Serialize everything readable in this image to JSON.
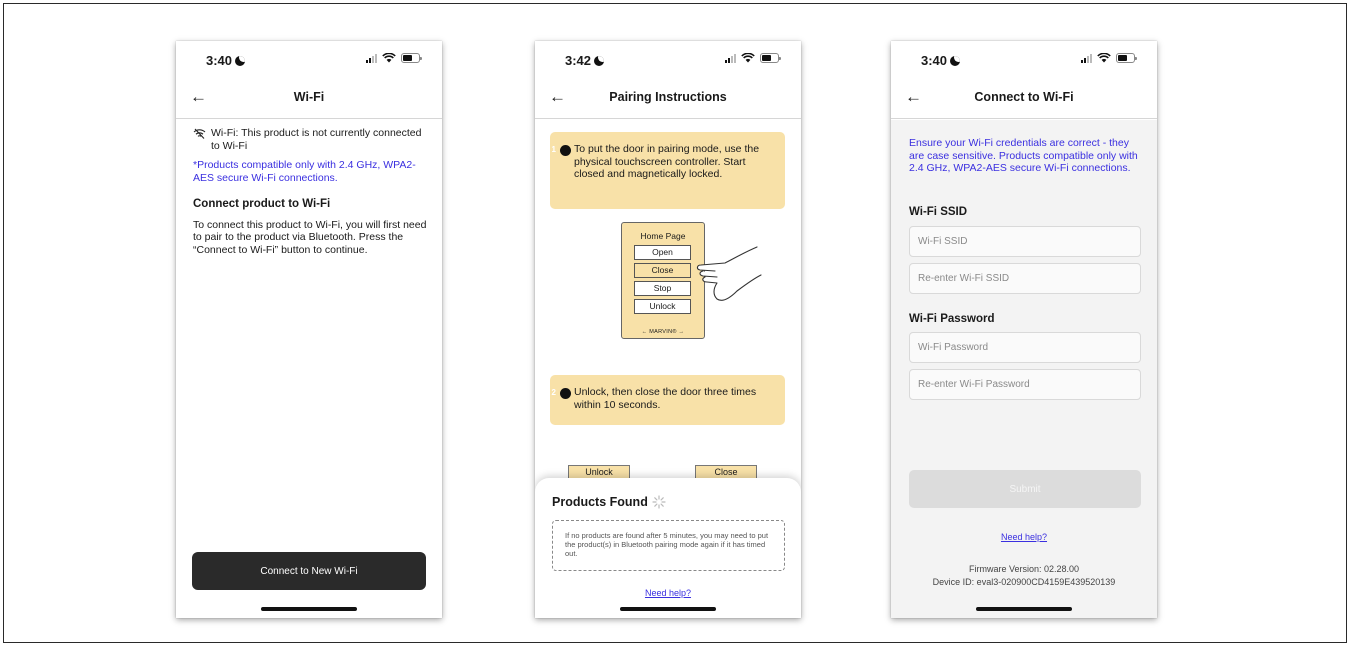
{
  "screens": [
    {
      "status_time": "3:40",
      "title": "Wi-Fi",
      "wifi_status": "Wi-Fi: This product is not currently connected to Wi-Fi",
      "compat_note": "*Products compatible only with 2.4 GHz, WPA2-AES secure Wi-Fi connections.",
      "section_heading": "Connect product to Wi-Fi",
      "section_text": "To connect this product to Wi-Fi, you will first need to pair to the product via Bluetooth. Press the “Connect to Wi-Fi” button to continue.",
      "button_label": "Connect to New Wi-Fi"
    },
    {
      "status_time": "3:42",
      "title": "Pairing Instructions",
      "step1_num": "1",
      "step1_text": "To put the door in pairing mode, use the physical touchscreen controller. Start closed and magnetically locked.",
      "controller": {
        "header": "Home Page",
        "buttons": [
          "Open",
          "Close",
          "Stop",
          "Unlock"
        ],
        "brand": "← MARVIN® →"
      },
      "step2_num": "2",
      "step2_text": "Unlock, then close the door three times within 10 seconds.",
      "mini_buttons": [
        "Unlock",
        "Close"
      ],
      "sheet_title": "Products Found",
      "sheet_note": "If no products are found after 5 minutes, you may need to put the product(s) in Bluetooth pairing mode again if it has timed out.",
      "help_link": "Need help?"
    },
    {
      "status_time": "3:40",
      "title": "Connect to Wi-Fi",
      "intro": "Ensure your Wi-Fi credentials are correct - they are case sensitive. Products compatible only with 2.4 GHz, WPA2-AES secure Wi-Fi connections.",
      "ssid_label": "Wi-Fi SSID",
      "ssid_placeholder": "Wi-Fi SSID",
      "ssid_confirm_placeholder": "Re-enter Wi-Fi SSID",
      "password_label": "Wi-Fi Password",
      "password_placeholder": "Wi-Fi Password",
      "password_confirm_placeholder": "Re-enter Wi-Fi Password",
      "submit_label": "Submit",
      "help_link": "Need help?",
      "firmware": "Firmware Version: 02.28.00",
      "device_id": "Device ID: eval3-020900CD4159E439520139"
    }
  ],
  "colors": {
    "accent_blue": "#3a2fe0",
    "instruction_card": "#f8e1a8",
    "dark_button": "#2a2a2a"
  },
  "icons": [
    "back-arrow-icon",
    "moon-icon",
    "signal-icon",
    "wifi-icon",
    "battery-icon",
    "wifi-off-icon",
    "spinner-icon",
    "hand-icon"
  ]
}
